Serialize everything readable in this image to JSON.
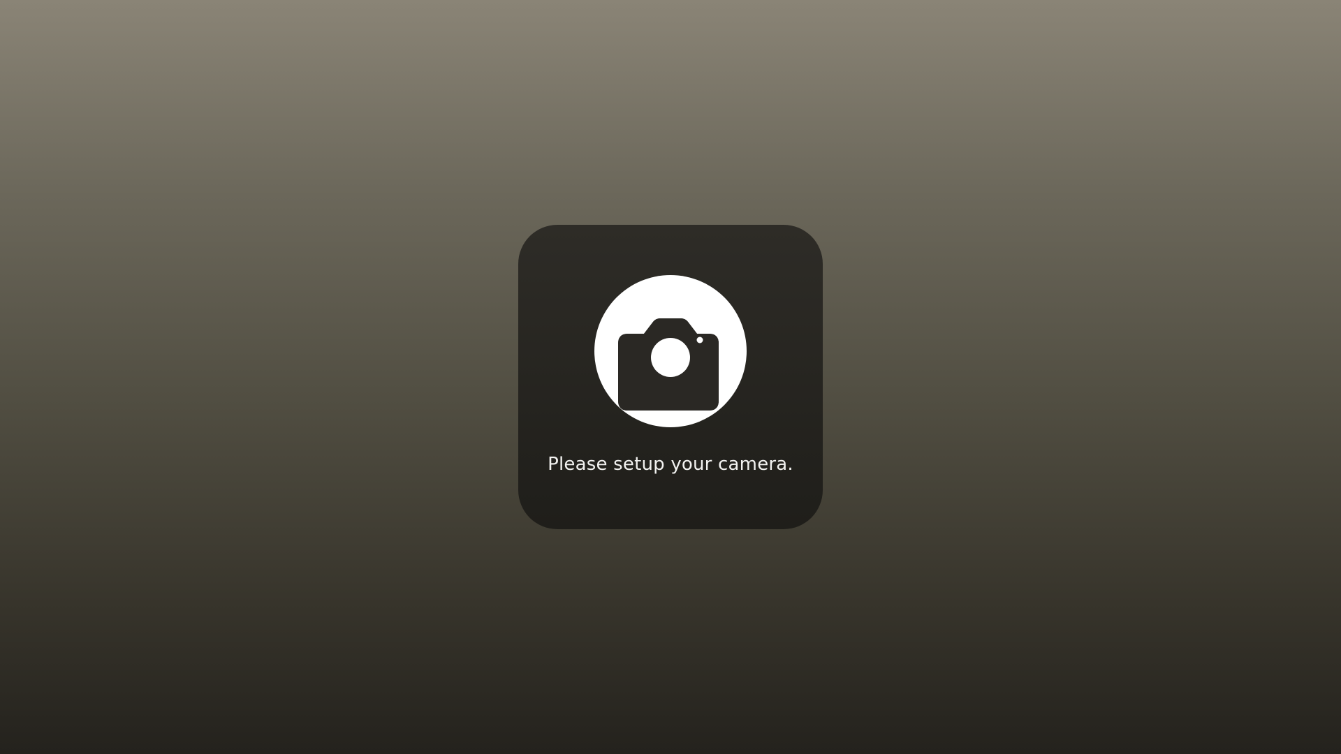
{
  "setup_card": {
    "icon": "camera-icon",
    "message": "Please setup your camera."
  },
  "colors": {
    "background_top": "#8a8476",
    "background_bottom": "#24221d",
    "card_background": "#2a2824",
    "icon_circle": "#ffffff",
    "text": "#f2f2f0"
  }
}
